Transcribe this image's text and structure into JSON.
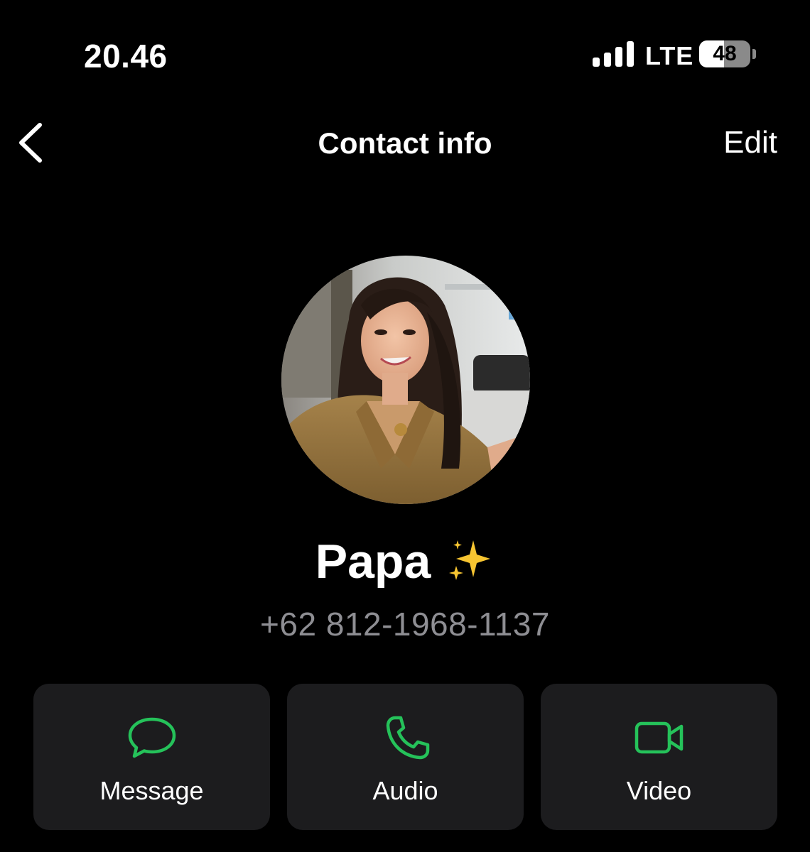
{
  "status_bar": {
    "time": "20.46",
    "network": "LTE",
    "battery_percent": "48",
    "battery_level": 0.48,
    "signal_bars": 4
  },
  "nav": {
    "title": "Contact info",
    "edit_label": "Edit",
    "back_icon": "chevron-left-icon"
  },
  "contact": {
    "name": "Papa",
    "name_emoji": "sparkles",
    "phone": "+62 812-1968-1137"
  },
  "actions": [
    {
      "label": "Message",
      "icon": "message-bubble-icon"
    },
    {
      "label": "Audio",
      "icon": "phone-icon"
    },
    {
      "label": "Video",
      "icon": "video-camera-icon"
    }
  ],
  "colors": {
    "background": "#000000",
    "accent": "#25c25a",
    "button_bg": "#1c1c1e",
    "secondary_text": "#8e8e93",
    "sparkle": "#f7c531"
  }
}
